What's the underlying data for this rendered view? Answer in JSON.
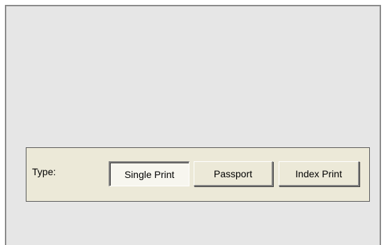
{
  "type_selector": {
    "label": "Type:",
    "options": [
      {
        "label": "Single Print",
        "selected": true
      },
      {
        "label": "Passport",
        "selected": false
      },
      {
        "label": "Index Print",
        "selected": false
      }
    ]
  },
  "colors": {
    "canvas": "#e6e6e6",
    "panel": "#ece9d8",
    "selected_button": "#f7f6ef"
  }
}
